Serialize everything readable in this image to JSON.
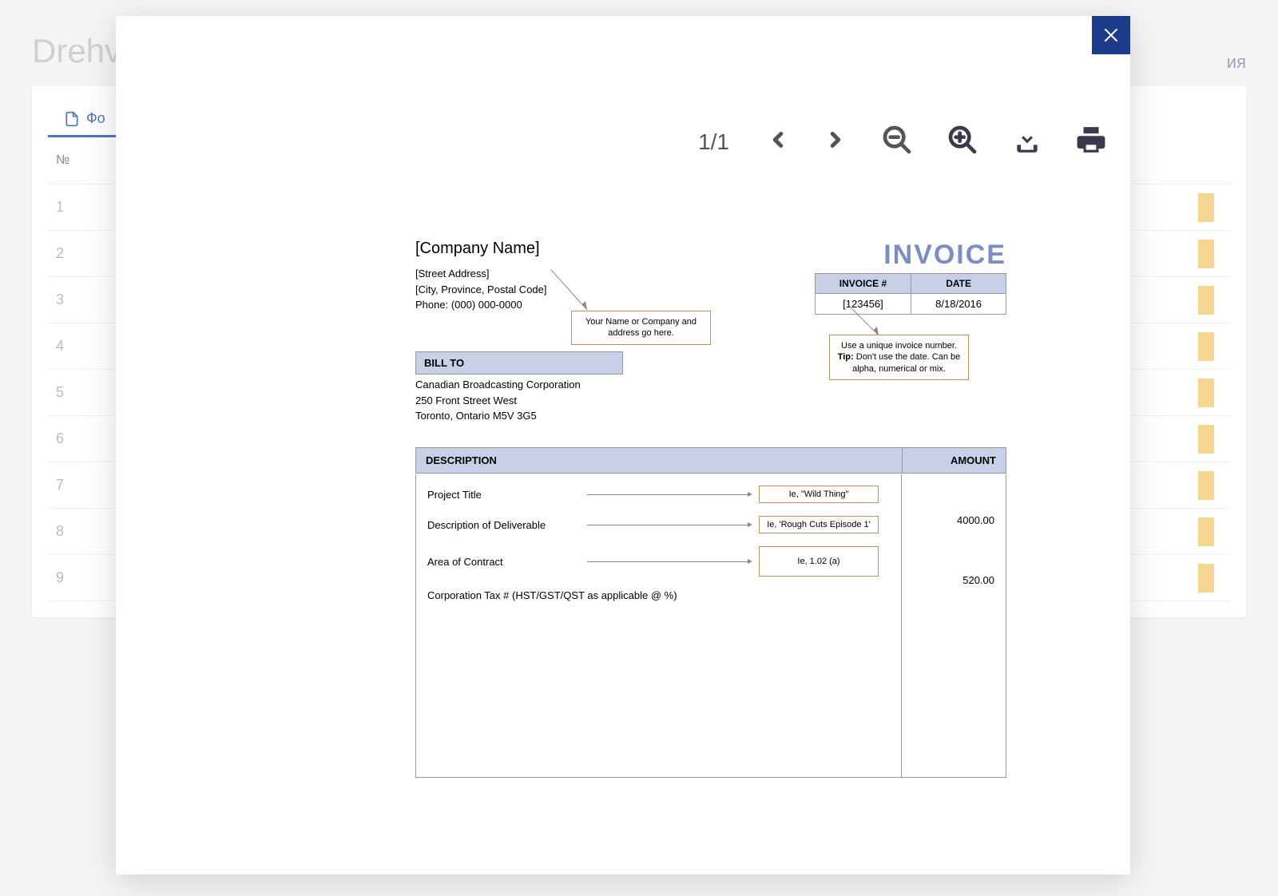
{
  "background": {
    "title": "Drehvc",
    "right_text": "ия",
    "tab_label": "Фо",
    "col_num": "№",
    "rows": [
      "1",
      "2",
      "3",
      "4",
      "5",
      "6",
      "7",
      "8",
      "9"
    ]
  },
  "viewer": {
    "page_indicator": "1/1"
  },
  "doc": {
    "company_name": "[Company Name]",
    "street": "[Street Address]",
    "city": "[City, Province, Postal Code]",
    "phone": "Phone: (000) 000-0000",
    "invoice_title": "INVOICE",
    "inv_num_label": "INVOICE #",
    "inv_date_label": "DATE",
    "inv_num": "[123456]",
    "inv_date": "8/18/2016",
    "callout1": "Your Name or Company and address go here.",
    "callout2_a": "Use a unique invoice number.",
    "callout2_tip": "Tip:",
    "callout2_b": " Don't use the date. Can be alpha, numerical or mix.",
    "billto_label": "BILL TO",
    "billto_name": "Canadian Broadcasting Corporation",
    "billto_street": "250 Front Street West",
    "billto_city": "Toronto, Ontario  M5V 3G5",
    "desc_header": "DESCRIPTION",
    "amount_header": "AMOUNT",
    "row1_label": "Project Title",
    "row1_ex": "Ie, \"Wild Thing\"",
    "row2_label": "Description of Deliverable",
    "row2_ex": "Ie, 'Rough Cuts Episode 1'",
    "row3_label": "Area of Contract",
    "row3_ex": "Ie, 1.02 (a)",
    "row4_label": "Corporation Tax # (HST/GST/QST as applicable @ %)",
    "amount1": "4000.00",
    "amount2": "520.00"
  }
}
